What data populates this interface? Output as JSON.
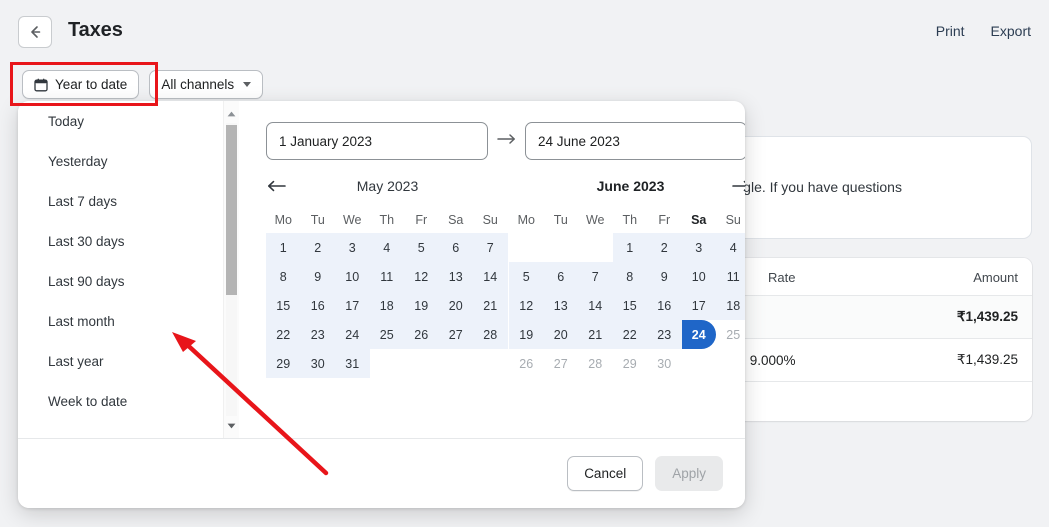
{
  "header": {
    "title": "Taxes",
    "back_icon": "arrow-left-icon",
    "actions": [
      {
        "label": "Print",
        "name": "print-link"
      },
      {
        "label": "Export",
        "name": "export-link"
      }
    ]
  },
  "filters": {
    "date_filter": {
      "label": "Year to date",
      "icon": "calendar-icon"
    },
    "channel_filter": {
      "label": "All channels",
      "icon": "chevron-down-icon"
    },
    "highlight_color": "#e8151a"
  },
  "background": {
    "notice_text": "Facebook or Google. If you have questions",
    "table": {
      "columns": [
        "Rate",
        "Amount"
      ],
      "rows": [
        {
          "rate": "",
          "amount": "₹1,439.25",
          "bold": true
        },
        {
          "rate": "9.000%",
          "amount": "₹1,439.25",
          "bold": false
        },
        {
          "rate": "",
          "amount": "",
          "bold": false
        }
      ]
    }
  },
  "popup": {
    "presets": [
      "Today",
      "Yesterday",
      "Last 7 days",
      "Last 30 days",
      "Last 90 days",
      "Last month",
      "Last year",
      "Week to date"
    ],
    "range": {
      "start_value": "1 January 2023",
      "end_value": "24 June 2023",
      "separator_icon": "arrow-right-icon"
    },
    "calendars": [
      {
        "title": "May 2023",
        "bold_title": false,
        "nav": "prev",
        "nav_icon": "arrow-left-icon",
        "dow": [
          "Mo",
          "Tu",
          "We",
          "Th",
          "Fr",
          "Sa",
          "Su"
        ],
        "bold_dow": "",
        "lead_blanks": 0,
        "days": [
          {
            "d": "1",
            "state": "in-range"
          },
          {
            "d": "2",
            "state": "in-range"
          },
          {
            "d": "3",
            "state": "in-range"
          },
          {
            "d": "4",
            "state": "in-range"
          },
          {
            "d": "5",
            "state": "in-range"
          },
          {
            "d": "6",
            "state": "in-range"
          },
          {
            "d": "7",
            "state": "in-range"
          },
          {
            "d": "8",
            "state": "in-range"
          },
          {
            "d": "9",
            "state": "in-range"
          },
          {
            "d": "10",
            "state": "in-range"
          },
          {
            "d": "11",
            "state": "in-range"
          },
          {
            "d": "12",
            "state": "in-range"
          },
          {
            "d": "13",
            "state": "in-range"
          },
          {
            "d": "14",
            "state": "in-range"
          },
          {
            "d": "15",
            "state": "in-range"
          },
          {
            "d": "16",
            "state": "in-range"
          },
          {
            "d": "17",
            "state": "in-range"
          },
          {
            "d": "18",
            "state": "in-range"
          },
          {
            "d": "19",
            "state": "in-range"
          },
          {
            "d": "20",
            "state": "in-range"
          },
          {
            "d": "21",
            "state": "in-range"
          },
          {
            "d": "22",
            "state": "in-range"
          },
          {
            "d": "23",
            "state": "in-range"
          },
          {
            "d": "24",
            "state": "in-range"
          },
          {
            "d": "25",
            "state": "in-range"
          },
          {
            "d": "26",
            "state": "in-range"
          },
          {
            "d": "27",
            "state": "in-range"
          },
          {
            "d": "28",
            "state": "in-range"
          },
          {
            "d": "29",
            "state": "in-range"
          },
          {
            "d": "30",
            "state": "in-range"
          },
          {
            "d": "31",
            "state": "in-range"
          }
        ]
      },
      {
        "title": "June 2023",
        "bold_title": true,
        "nav": "next",
        "nav_icon": "arrow-right-icon",
        "dow": [
          "Mo",
          "Tu",
          "We",
          "Th",
          "Fr",
          "Sa",
          "Su"
        ],
        "bold_dow": "Sa",
        "lead_blanks": 3,
        "days": [
          {
            "d": "1",
            "state": "in-range"
          },
          {
            "d": "2",
            "state": "in-range"
          },
          {
            "d": "3",
            "state": "in-range"
          },
          {
            "d": "4",
            "state": "in-range"
          },
          {
            "d": "5",
            "state": "in-range"
          },
          {
            "d": "6",
            "state": "in-range"
          },
          {
            "d": "7",
            "state": "in-range"
          },
          {
            "d": "8",
            "state": "in-range"
          },
          {
            "d": "9",
            "state": "in-range"
          },
          {
            "d": "10",
            "state": "in-range"
          },
          {
            "d": "11",
            "state": "in-range"
          },
          {
            "d": "12",
            "state": "in-range"
          },
          {
            "d": "13",
            "state": "in-range"
          },
          {
            "d": "14",
            "state": "in-range"
          },
          {
            "d": "15",
            "state": "in-range"
          },
          {
            "d": "16",
            "state": "in-range"
          },
          {
            "d": "17",
            "state": "in-range"
          },
          {
            "d": "18",
            "state": "in-range"
          },
          {
            "d": "19",
            "state": "in-range"
          },
          {
            "d": "20",
            "state": "in-range"
          },
          {
            "d": "21",
            "state": "in-range"
          },
          {
            "d": "22",
            "state": "in-range"
          },
          {
            "d": "23",
            "state": "in-range"
          },
          {
            "d": "24",
            "state": "selected"
          },
          {
            "d": "25",
            "state": "muted"
          },
          {
            "d": "26",
            "state": "muted"
          },
          {
            "d": "27",
            "state": "muted"
          },
          {
            "d": "28",
            "state": "muted"
          },
          {
            "d": "29",
            "state": "muted"
          },
          {
            "d": "30",
            "state": "muted"
          }
        ]
      }
    ],
    "footer": {
      "cancel_label": "Cancel",
      "apply_label": "Apply",
      "apply_disabled": true
    },
    "scrollbar": {
      "up_icon": "triangle-up-icon",
      "down_icon": "triangle-down-icon"
    }
  },
  "colors": {
    "accent": "#1f66c8",
    "range": "#edf2fa",
    "annotation": "#e8151a"
  }
}
